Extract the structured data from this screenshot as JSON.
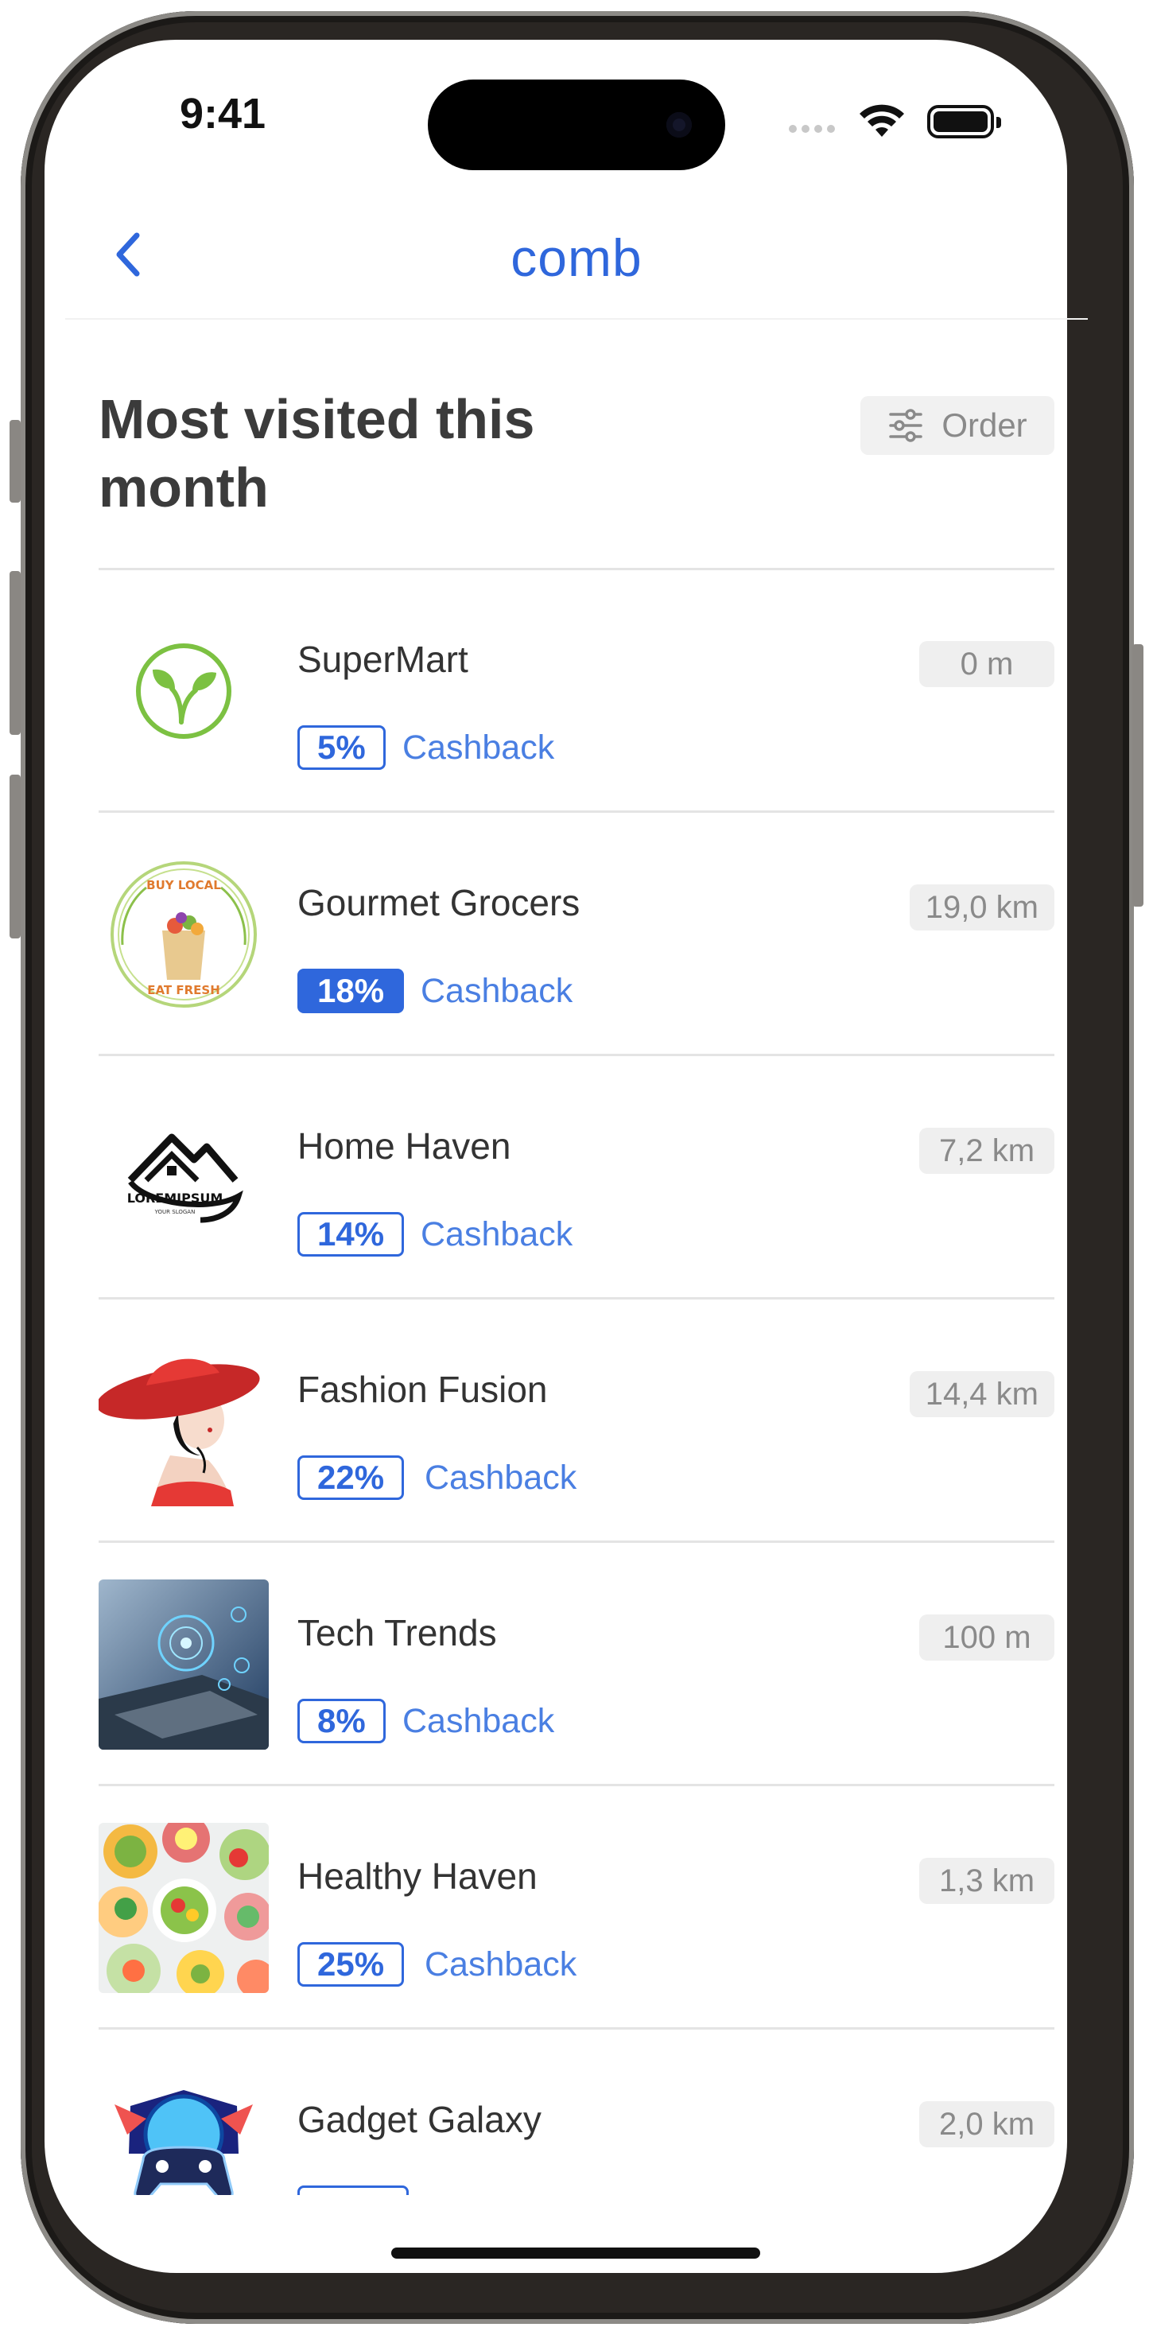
{
  "status_bar": {
    "time": "9:41"
  },
  "nav": {
    "logo": "comb"
  },
  "header": {
    "title": "Most visited this month",
    "order_label": "Order"
  },
  "stores": [
    {
      "name": "SuperMart",
      "distance": "0 m",
      "cashback_percent": "5%",
      "cashback_label": "Cashback",
      "highlighted": false
    },
    {
      "name": "Gourmet Grocers",
      "distance": "19,0 km",
      "cashback_percent": "18%",
      "cashback_label": "Cashback",
      "highlighted": true,
      "logo_text_top": "BUY LOCAL",
      "logo_text_bottom": "EAT FRESH"
    },
    {
      "name": "Home Haven",
      "distance": "7,2 km",
      "cashback_percent": "14%",
      "cashback_label": "Cashback",
      "highlighted": false,
      "logo_text": "LOREMIPSUM",
      "logo_subtext": "YOUR SLOGAN"
    },
    {
      "name": "Fashion Fusion",
      "distance": "14,4 km",
      "cashback_percent": "22%",
      "cashback_label": "Cashback",
      "highlighted": false
    },
    {
      "name": "Tech Trends",
      "distance": "100 m",
      "cashback_percent": "8%",
      "cashback_label": "Cashback",
      "highlighted": false
    },
    {
      "name": "Healthy Haven",
      "distance": "1,3 km",
      "cashback_percent": "25%",
      "cashback_label": "Cashback",
      "highlighted": false
    },
    {
      "name": "Gadget Galaxy",
      "distance": "2,0 km",
      "cashback_percent": "",
      "cashback_label": "",
      "highlighted": false
    }
  ],
  "colors": {
    "accent": "#2f67dc",
    "cashback_text": "#4a7fe2",
    "title": "#3b3b3b",
    "badge_bg": "#efefef"
  }
}
